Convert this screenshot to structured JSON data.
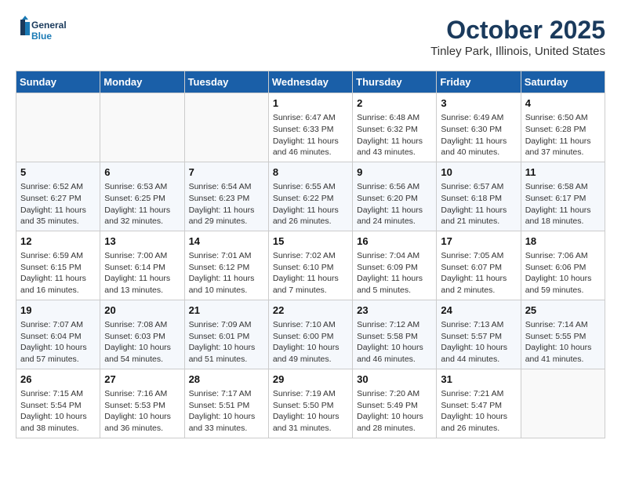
{
  "header": {
    "logo": {
      "line1": "General",
      "line2": "Blue"
    },
    "title": "October 2025",
    "location": "Tinley Park, Illinois, United States"
  },
  "weekdays": [
    "Sunday",
    "Monday",
    "Tuesday",
    "Wednesday",
    "Thursday",
    "Friday",
    "Saturday"
  ],
  "weeks": [
    [
      {
        "day": "",
        "info": ""
      },
      {
        "day": "",
        "info": ""
      },
      {
        "day": "",
        "info": ""
      },
      {
        "day": "1",
        "info": "Sunrise: 6:47 AM\nSunset: 6:33 PM\nDaylight: 11 hours\nand 46 minutes."
      },
      {
        "day": "2",
        "info": "Sunrise: 6:48 AM\nSunset: 6:32 PM\nDaylight: 11 hours\nand 43 minutes."
      },
      {
        "day": "3",
        "info": "Sunrise: 6:49 AM\nSunset: 6:30 PM\nDaylight: 11 hours\nand 40 minutes."
      },
      {
        "day": "4",
        "info": "Sunrise: 6:50 AM\nSunset: 6:28 PM\nDaylight: 11 hours\nand 37 minutes."
      }
    ],
    [
      {
        "day": "5",
        "info": "Sunrise: 6:52 AM\nSunset: 6:27 PM\nDaylight: 11 hours\nand 35 minutes."
      },
      {
        "day": "6",
        "info": "Sunrise: 6:53 AM\nSunset: 6:25 PM\nDaylight: 11 hours\nand 32 minutes."
      },
      {
        "day": "7",
        "info": "Sunrise: 6:54 AM\nSunset: 6:23 PM\nDaylight: 11 hours\nand 29 minutes."
      },
      {
        "day": "8",
        "info": "Sunrise: 6:55 AM\nSunset: 6:22 PM\nDaylight: 11 hours\nand 26 minutes."
      },
      {
        "day": "9",
        "info": "Sunrise: 6:56 AM\nSunset: 6:20 PM\nDaylight: 11 hours\nand 24 minutes."
      },
      {
        "day": "10",
        "info": "Sunrise: 6:57 AM\nSunset: 6:18 PM\nDaylight: 11 hours\nand 21 minutes."
      },
      {
        "day": "11",
        "info": "Sunrise: 6:58 AM\nSunset: 6:17 PM\nDaylight: 11 hours\nand 18 minutes."
      }
    ],
    [
      {
        "day": "12",
        "info": "Sunrise: 6:59 AM\nSunset: 6:15 PM\nDaylight: 11 hours\nand 16 minutes."
      },
      {
        "day": "13",
        "info": "Sunrise: 7:00 AM\nSunset: 6:14 PM\nDaylight: 11 hours\nand 13 minutes."
      },
      {
        "day": "14",
        "info": "Sunrise: 7:01 AM\nSunset: 6:12 PM\nDaylight: 11 hours\nand 10 minutes."
      },
      {
        "day": "15",
        "info": "Sunrise: 7:02 AM\nSunset: 6:10 PM\nDaylight: 11 hours\nand 7 minutes."
      },
      {
        "day": "16",
        "info": "Sunrise: 7:04 AM\nSunset: 6:09 PM\nDaylight: 11 hours\nand 5 minutes."
      },
      {
        "day": "17",
        "info": "Sunrise: 7:05 AM\nSunset: 6:07 PM\nDaylight: 11 hours\nand 2 minutes."
      },
      {
        "day": "18",
        "info": "Sunrise: 7:06 AM\nSunset: 6:06 PM\nDaylight: 10 hours\nand 59 minutes."
      }
    ],
    [
      {
        "day": "19",
        "info": "Sunrise: 7:07 AM\nSunset: 6:04 PM\nDaylight: 10 hours\nand 57 minutes."
      },
      {
        "day": "20",
        "info": "Sunrise: 7:08 AM\nSunset: 6:03 PM\nDaylight: 10 hours\nand 54 minutes."
      },
      {
        "day": "21",
        "info": "Sunrise: 7:09 AM\nSunset: 6:01 PM\nDaylight: 10 hours\nand 51 minutes."
      },
      {
        "day": "22",
        "info": "Sunrise: 7:10 AM\nSunset: 6:00 PM\nDaylight: 10 hours\nand 49 minutes."
      },
      {
        "day": "23",
        "info": "Sunrise: 7:12 AM\nSunset: 5:58 PM\nDaylight: 10 hours\nand 46 minutes."
      },
      {
        "day": "24",
        "info": "Sunrise: 7:13 AM\nSunset: 5:57 PM\nDaylight: 10 hours\nand 44 minutes."
      },
      {
        "day": "25",
        "info": "Sunrise: 7:14 AM\nSunset: 5:55 PM\nDaylight: 10 hours\nand 41 minutes."
      }
    ],
    [
      {
        "day": "26",
        "info": "Sunrise: 7:15 AM\nSunset: 5:54 PM\nDaylight: 10 hours\nand 38 minutes."
      },
      {
        "day": "27",
        "info": "Sunrise: 7:16 AM\nSunset: 5:53 PM\nDaylight: 10 hours\nand 36 minutes."
      },
      {
        "day": "28",
        "info": "Sunrise: 7:17 AM\nSunset: 5:51 PM\nDaylight: 10 hours\nand 33 minutes."
      },
      {
        "day": "29",
        "info": "Sunrise: 7:19 AM\nSunset: 5:50 PM\nDaylight: 10 hours\nand 31 minutes."
      },
      {
        "day": "30",
        "info": "Sunrise: 7:20 AM\nSunset: 5:49 PM\nDaylight: 10 hours\nand 28 minutes."
      },
      {
        "day": "31",
        "info": "Sunrise: 7:21 AM\nSunset: 5:47 PM\nDaylight: 10 hours\nand 26 minutes."
      },
      {
        "day": "",
        "info": ""
      }
    ]
  ]
}
